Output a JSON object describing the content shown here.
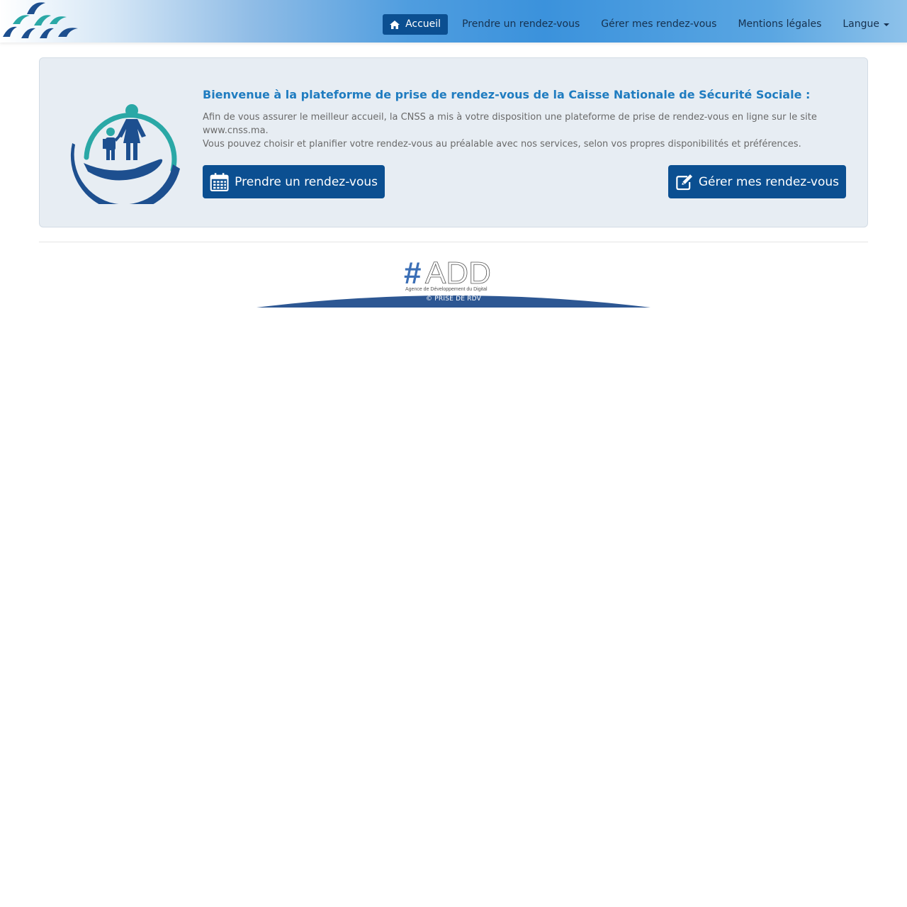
{
  "header": {
    "logo_icon": "cnss-logo-icon",
    "nav": {
      "home_label": "Accueil",
      "home_icon": "home-icon",
      "take_appointment_label": "Prendre un rendez-vous",
      "manage_appointments_label": "Gérer mes rendez-vous",
      "legal_label": "Mentions légales",
      "language_label": "Langue"
    }
  },
  "welcome": {
    "illustration_icon": "family-hand-icon",
    "title": "Bienvenue à la plateforme de prise de rendez-vous de la Caisse Nationale de Sécurité Sociale :",
    "paragraph_1": "Afin de vous assurer le meilleur accueil, la CNSS a mis à votre disposition une plateforme de prise de rendez-vous en ligne sur le site www.cnss.ma.",
    "paragraph_2": "Vous pouvez choisir et planifier votre rendez-vous au préalable avec nos services, selon vos propres disponibilités et préférences.",
    "take_button_label": "Prendre un rendez-vous",
    "take_button_icon": "calendar-icon",
    "manage_button_label": "Gérer mes rendez-vous",
    "manage_button_icon": "edit-icon"
  },
  "footer": {
    "logo_text": "#ADD",
    "logo_subtitle": "Agence de Développement du Digital",
    "copyright": "© PRISE DE RDV"
  },
  "colors": {
    "primary": "#0b4f91",
    "title": "#1f7cc0",
    "teal": "#2aa8a6",
    "panel_bg": "#e7edf3"
  }
}
